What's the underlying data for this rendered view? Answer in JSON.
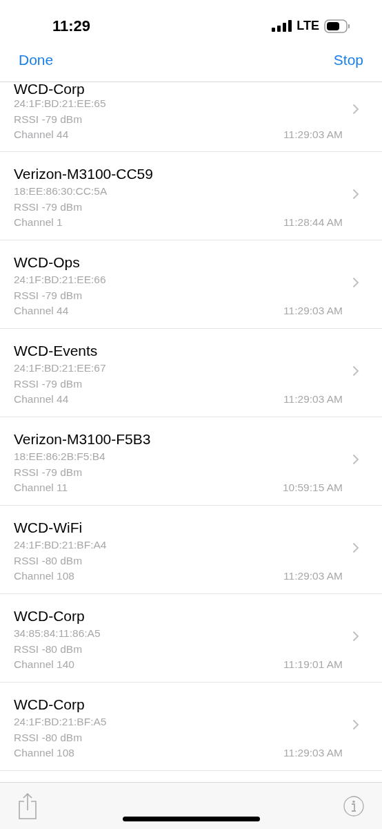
{
  "status_bar": {
    "time": "11:29",
    "network": "LTE"
  },
  "nav_bar": {
    "left_button": "Done",
    "right_button": "Stop"
  },
  "networks": [
    {
      "name": "WCD-Corp",
      "bssid": "24:1F:BD:21:EE:65",
      "rssi": "RSSI -79 dBm",
      "channel": "Channel 44",
      "seen": "11:29:03 AM"
    },
    {
      "name": "Verizon-M3100-CC59",
      "bssid": "18:EE:86:30:CC:5A",
      "rssi": "RSSI -79 dBm",
      "channel": "Channel 1",
      "seen": "11:28:44 AM"
    },
    {
      "name": "WCD-Ops",
      "bssid": "24:1F:BD:21:EE:66",
      "rssi": "RSSI -79 dBm",
      "channel": "Channel 44",
      "seen": "11:29:03 AM"
    },
    {
      "name": "WCD-Events",
      "bssid": "24:1F:BD:21:EE:67",
      "rssi": "RSSI -79 dBm",
      "channel": "Channel 44",
      "seen": "11:29:03 AM"
    },
    {
      "name": "Verizon-M3100-F5B3",
      "bssid": "18:EE:86:2B:F5:B4",
      "rssi": "RSSI -79 dBm",
      "channel": "Channel 11",
      "seen": "10:59:15 AM"
    },
    {
      "name": "WCD-WiFi",
      "bssid": "24:1F:BD:21:BF:A4",
      "rssi": "RSSI -80 dBm",
      "channel": "Channel 108",
      "seen": "11:29:03 AM"
    },
    {
      "name": "WCD-Corp",
      "bssid": "34:85:84:11:86:A5",
      "rssi": "RSSI -80 dBm",
      "channel": "Channel 140",
      "seen": "11:19:01 AM"
    },
    {
      "name": "WCD-Corp",
      "bssid": "24:1F:BD:21:BF:A5",
      "rssi": "RSSI -80 dBm",
      "channel": "Channel 108",
      "seen": "11:29:03 AM"
    }
  ]
}
